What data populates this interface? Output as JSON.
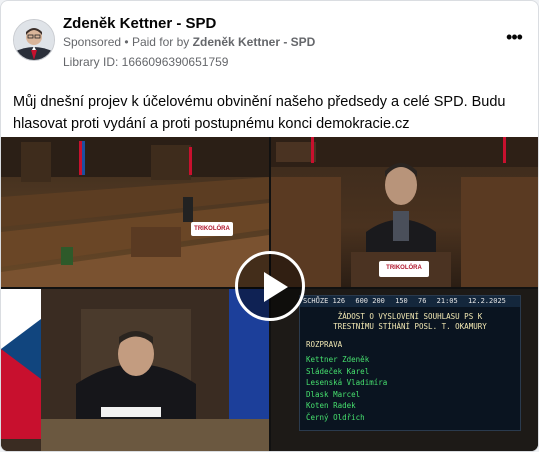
{
  "post": {
    "page_name": "Zdeněk Kettner - SPD",
    "sponsored": "Sponsored",
    "separator": "•",
    "paid_for_by": "Paid for by",
    "payer": "Zdeněk Kettner - SPD",
    "library_id": "Library ID: 1666096390651759",
    "more_icon": "•••",
    "text": "Můj dnešní projev k účelovému obvinění našeho předsedy a celé SPD. Budu hlasovat proti vydání a proti postupnému konci demokracie.cz"
  },
  "video": {
    "play_icon": "play-icon",
    "sign_text": "TRIKOLÓRA",
    "board": {
      "top_items": [
        "SCHŮZE 126",
        "600 200",
        "150",
        "76",
        "21:05",
        "12.2.2025"
      ],
      "title_line1": "ŽÁDOST O VYSLOVENÍ SOUHLASU PS K",
      "title_line2": "TRESTNÍMU STÍHÁNÍ POSL. T. OKAMURY",
      "rozprava": "ROZPRAVA",
      "names": [
        "Kettner Zdeněk",
        "Sládeček Karel",
        "Lesenská Vladimíra",
        "Dlask Marcel",
        "Koten Radek",
        "Černý Oldřich"
      ]
    }
  }
}
